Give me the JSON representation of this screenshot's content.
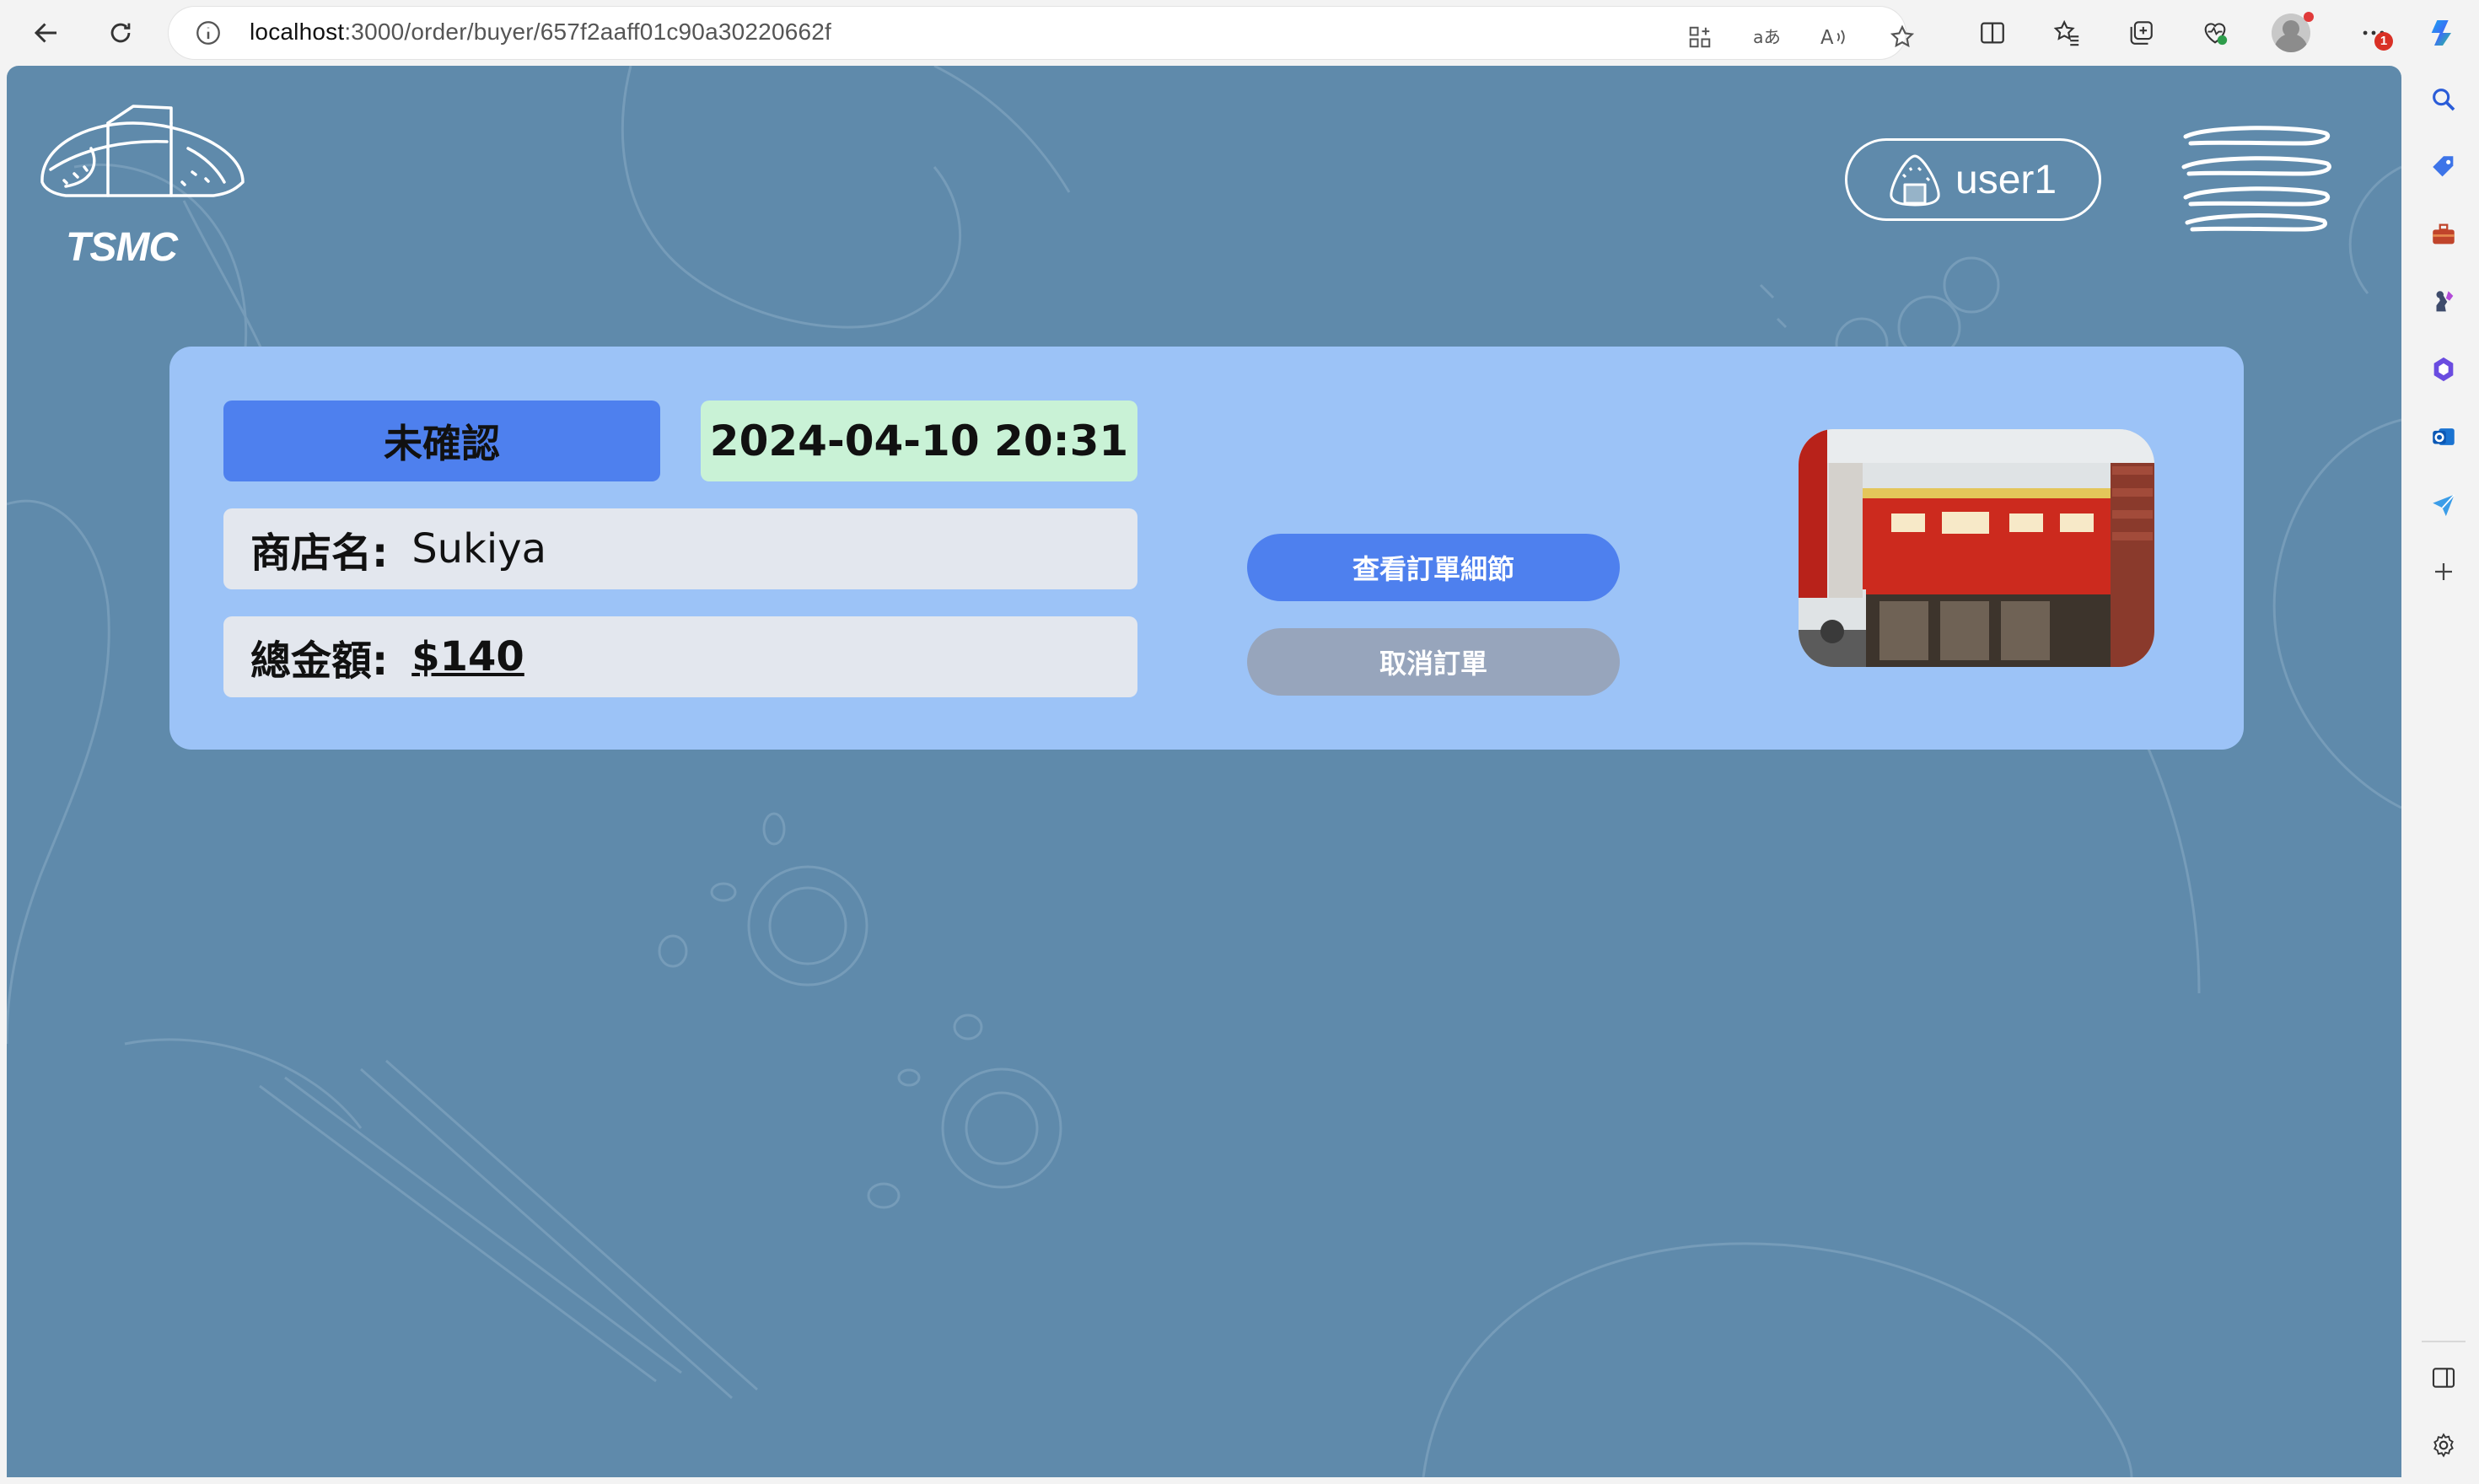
{
  "browser": {
    "url_host": "localhost",
    "url_path": ":3000/order/buyer/657f2aaff01c90a30220662f",
    "notification_count": "1",
    "icons": [
      "back-icon",
      "refresh-icon",
      "site-info-icon",
      "apps-icon",
      "translate-icon",
      "read-aloud-icon",
      "favorite-star-icon",
      "split-screen-icon",
      "favorites-icon",
      "collections-icon",
      "browser-essentials-icon",
      "profile-avatar",
      "more-icon",
      "copilot-icon"
    ]
  },
  "sidebar": {
    "icons": [
      "search-icon",
      "shopping-tag-icon",
      "tools-briefcase-icon",
      "games-icon",
      "microsoft365-icon",
      "outlook-icon",
      "send-icon",
      "add-icon",
      "sidebar-toggle-icon",
      "settings-gear-icon"
    ]
  },
  "app": {
    "logo_text": "TSMC",
    "user": {
      "name": "user1"
    }
  },
  "order": {
    "status": "未確認",
    "datetime": "2024-04-10 20:31",
    "store_label": "商店名:",
    "store_name": "Sukiya",
    "total_label": "總金額:",
    "total": "$140",
    "details_button": "查看訂單細節",
    "cancel_button": "取消訂單"
  },
  "colors": {
    "background": "#5f8aab",
    "card": "#9cc3f7",
    "status_badge": "#4e80ee",
    "datetime_badge": "#c9f2d6",
    "field": "#e3e7ee",
    "primary_button": "#4e80ee",
    "disabled_button": "#97a5bc"
  }
}
